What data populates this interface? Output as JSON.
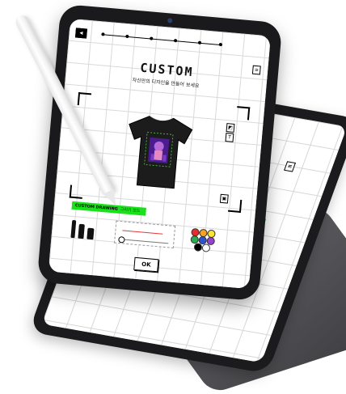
{
  "app": {
    "title": "CUSTOM",
    "subtitle": "자신만의 디자인을 만들어 보세요"
  },
  "progress": {
    "steps": 6,
    "current_step": 1
  },
  "icons": {
    "back": "arrow-left-icon",
    "menu": "menu-icon",
    "layer": "layer-icon",
    "text": "text-icon",
    "image": "image-icon"
  },
  "drawing_panel": {
    "label": "CUSTOM DRAWING",
    "sublabel": "그리기 모드"
  },
  "colors": {
    "accent_green": "#19e21b",
    "stroke_red": "#e23a3a",
    "palette": [
      "#e52d2d",
      "#f4a12a",
      "#f7e436",
      "#22b14c",
      "#2c53d6",
      "#9b3fd4",
      "#000000",
      "#ffffff"
    ]
  },
  "actions": {
    "ok_label": "OK"
  },
  "tshirt": {
    "color": "#1c1c1c",
    "print": "purple-character-artwork"
  }
}
